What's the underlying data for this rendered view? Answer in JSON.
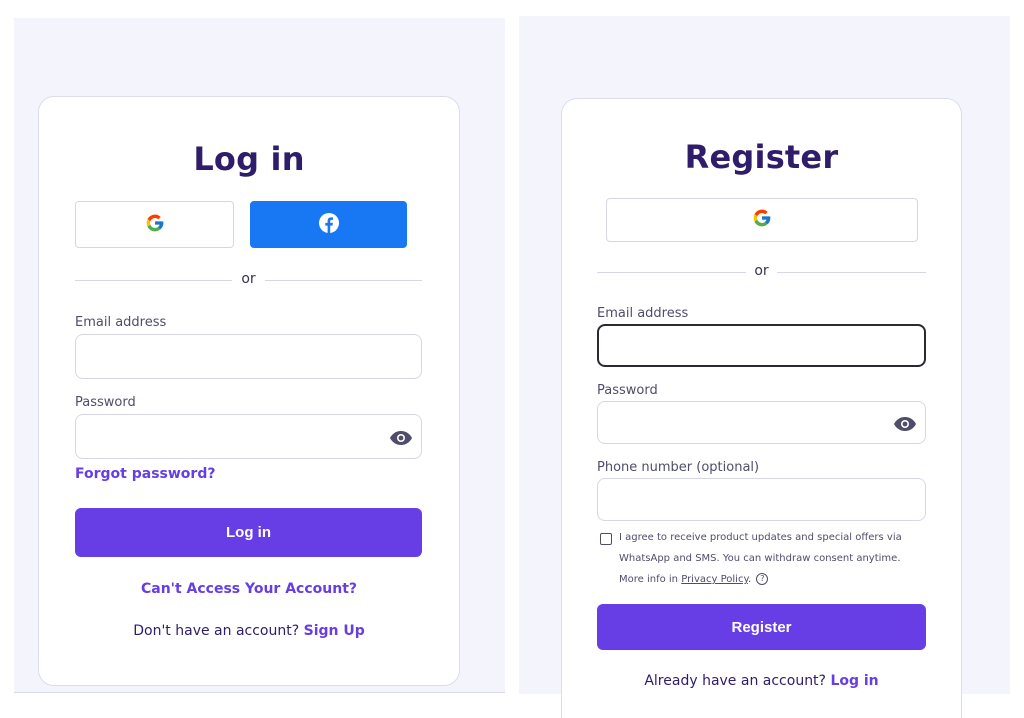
{
  "login": {
    "title": "Log in",
    "divider": "or",
    "email_label": "Email address",
    "email_value": "",
    "password_label": "Password",
    "password_value": "",
    "forgot_link": "Forgot password?",
    "submit_label": "Log in",
    "access_link": "Can't Access Your Account?",
    "signup_prompt": "Don't have an account?",
    "signup_link": "Sign Up"
  },
  "register": {
    "title": "Register",
    "divider": "or",
    "email_label": "Email address",
    "email_value": "",
    "password_label": "Password",
    "password_value": "",
    "phone_label": "Phone number (optional)",
    "phone_value": "",
    "consent_text": "I agree to receive product updates and special offers via WhatsApp and SMS. You can withdraw consent anytime. More info in",
    "privacy_link": "Privacy Policy",
    "consent_end": ".",
    "help_symbol": "?",
    "submit_label": "Register",
    "login_prompt": "Already have an account?",
    "login_link": "Log in"
  },
  "icons": {
    "google": "google-icon",
    "facebook": "facebook-icon",
    "eye": "eye-icon",
    "help": "question-circle-icon"
  },
  "colors": {
    "accent": "#673de6",
    "heading": "#2f1c6a",
    "facebook": "#1877f2",
    "background": "#f4f4fd"
  }
}
